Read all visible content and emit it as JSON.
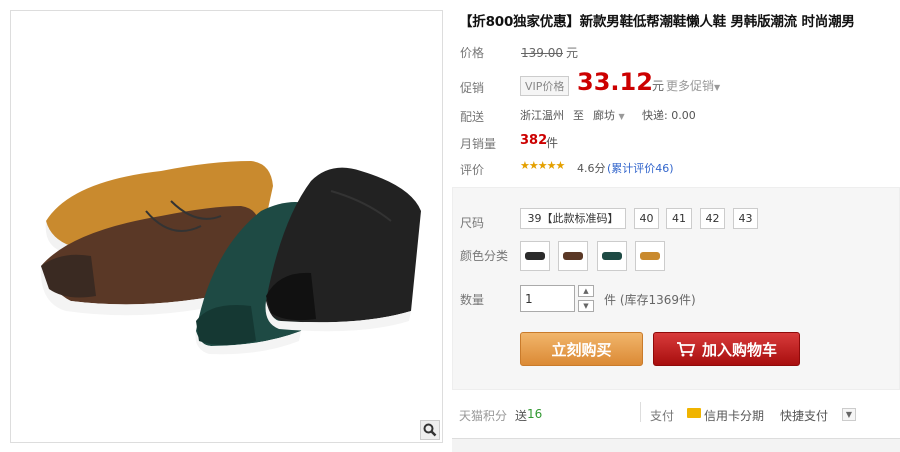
{
  "product": {
    "title": "【折800独家优惠】新款男鞋低帮潮鞋懒人鞋 男韩版潮流 时尚潮男",
    "image_alt": "shoes-photo"
  },
  "price": {
    "label": "价格",
    "original": "139.00",
    "unit": "元"
  },
  "promo": {
    "label": "促销",
    "vip_badge": "VIP价格",
    "price": "33.12",
    "unit": "元",
    "more": "更多促销",
    "more_icon": "chevron-down-icon"
  },
  "shipping": {
    "label": "配送",
    "from": "浙江温州",
    "to_word": "至",
    "to": "廊坊",
    "express": "快递: 0.00"
  },
  "sales": {
    "label": "月销量",
    "count": "382",
    "unit": "件"
  },
  "rating": {
    "label": "评价",
    "stars": "★★★★★",
    "score": "4.6分",
    "reviews": "(累计评价46)"
  },
  "sku": {
    "size_label": "尺码",
    "sizes": [
      "39【此款标准码】",
      "40",
      "41",
      "42",
      "43"
    ],
    "color_label": "颜色分类",
    "colors": [
      "#2b2b2b",
      "#5a3826",
      "#1e4a44",
      "#c98a2e"
    ],
    "qty_label": "数量",
    "qty_value": "1",
    "stock": "件 (库存1369件)"
  },
  "actions": {
    "buy_now": "立刻购买",
    "add_cart": "加入购物车"
  },
  "footer": {
    "points_label": "天猫积分",
    "points_prefix": "送",
    "points_value": "16",
    "pay_label": "支付",
    "credit": "信用卡分期",
    "quick": "快捷支付"
  },
  "colors": {
    "promo_red": "#cc0000",
    "buy_orange": "#db8a35",
    "cart_red": "#b31414"
  }
}
